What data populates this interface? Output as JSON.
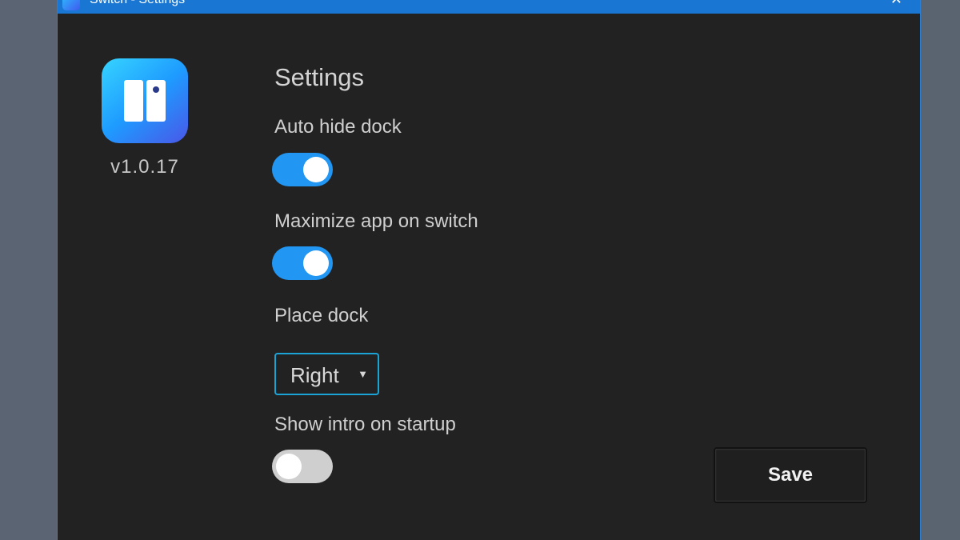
{
  "window": {
    "title": "Switch - Settings",
    "close_glyph": "✕"
  },
  "app": {
    "logo_icon": "switch-app-icon",
    "version": "v1.0.17"
  },
  "settings": {
    "heading": "Settings",
    "auto_hide_dock": {
      "label": "Auto hide dock",
      "enabled": true
    },
    "maximize_app_on_switch": {
      "label": "Maximize app on switch",
      "enabled": true
    },
    "place_dock": {
      "label": "Place dock",
      "value": "Right",
      "arrow": "▼"
    },
    "show_intro_on_startup": {
      "label": "Show intro on startup",
      "enabled": false
    }
  },
  "actions": {
    "save_label": "Save"
  },
  "colors": {
    "accent": "#2196f3",
    "titlebar": "#1976d2",
    "background": "#222222",
    "select_border": "#1ba3d6"
  }
}
